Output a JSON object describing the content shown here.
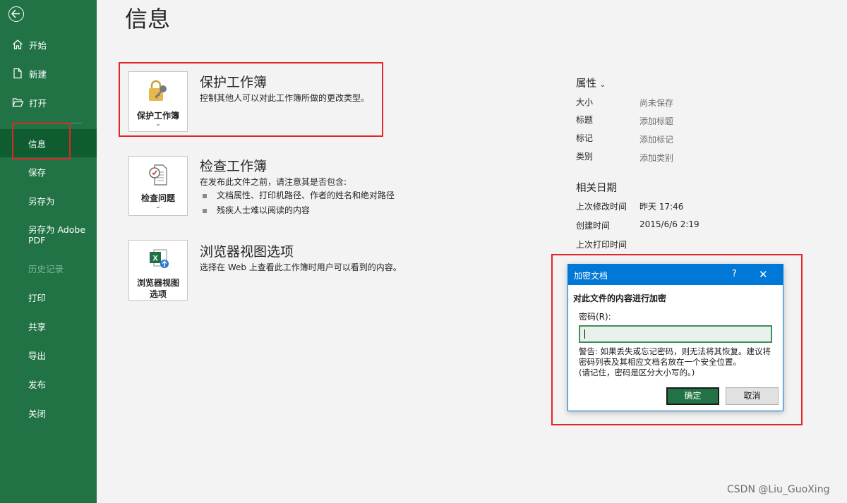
{
  "sidebar": {
    "items": [
      {
        "label": "开始",
        "icon": "home-icon"
      },
      {
        "label": "新建",
        "icon": "new-document-icon"
      },
      {
        "label": "打开",
        "icon": "open-folder-icon"
      },
      {
        "label": "信息"
      },
      {
        "label": "保存"
      },
      {
        "label": "另存为"
      },
      {
        "label": "另存为 Adobe PDF"
      },
      {
        "label": "历史记录"
      },
      {
        "label": "打印"
      },
      {
        "label": "共享"
      },
      {
        "label": "导出"
      },
      {
        "label": "发布"
      },
      {
        "label": "关闭"
      }
    ],
    "active": "信息"
  },
  "page": {
    "title": "信息"
  },
  "sections": {
    "protect": {
      "tile_label": "保护工作簿",
      "title": "保护工作簿",
      "desc": "控制其他人可以对此工作簿所做的更改类型。"
    },
    "inspect": {
      "tile_label": "检查问题",
      "title": "检查工作簿",
      "desc": "在发布此文件之前，请注意其是否包含:",
      "bullets": [
        "文档属性、打印机路径、作者的姓名和绝对路径",
        "残疾人士难以阅读的内容"
      ]
    },
    "browser": {
      "tile_label_1": "浏览器视图",
      "tile_label_2": "选项",
      "title": "浏览器视图选项",
      "desc": "选择在 Web 上查看此工作簿时用户可以看到的内容。"
    }
  },
  "properties": {
    "heading": "属性",
    "rows": [
      {
        "label": "大小",
        "value": "尚未保存"
      },
      {
        "label": "标题",
        "value": "添加标题"
      },
      {
        "label": "标记",
        "value": "添加标记"
      },
      {
        "label": "类别",
        "value": "添加类别"
      }
    ]
  },
  "dates": {
    "heading": "相关日期",
    "rows": [
      {
        "label": "上次修改时间",
        "value": "昨天 17:46"
      },
      {
        "label": "创建时间",
        "value": "2015/6/6 2:19"
      },
      {
        "label": "上次打印时间",
        "value": ""
      }
    ]
  },
  "dialog": {
    "title": "加密文档",
    "help": "?",
    "close": "✕",
    "heading": "对此文件的内容进行加密",
    "password_label": "密码(R):",
    "password_value": "",
    "warning_1": "警告: 如果丢失或忘记密码，则无法将其恢复。建议将密码列表及其相应文档名放在一个安全位置。",
    "warning_2": "(请记住，密码是区分大小写的。)",
    "ok": "确定",
    "cancel": "取消"
  },
  "watermark": "CSDN @Liu_GuoXing",
  "colors": {
    "sidebar": "#217346",
    "active": "#0e5c2f",
    "highlight": "#e0252c",
    "dialog_accent": "#0078d7"
  }
}
